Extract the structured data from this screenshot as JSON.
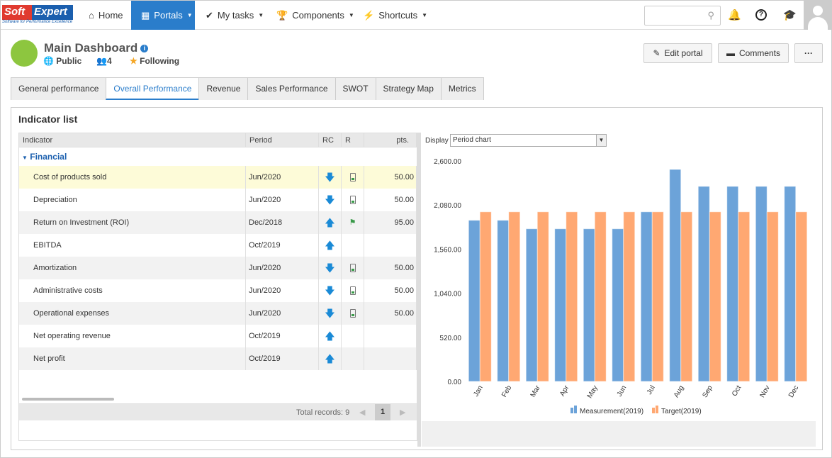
{
  "logo": {
    "text1": "Soft",
    "text2": "Expert",
    "tagline": "Software for Performance Excellence"
  },
  "nav": {
    "home": "Home",
    "portals": "Portals",
    "my_tasks": "My tasks",
    "components": "Components",
    "shortcuts": "Shortcuts"
  },
  "search": {
    "placeholder": ""
  },
  "portal": {
    "title": "Main Dashboard",
    "visibility": "Public",
    "members": "4",
    "following": "Following"
  },
  "actions": {
    "edit": "Edit portal",
    "comments": "Comments",
    "more": "···"
  },
  "tabs": [
    "General performance",
    "Overall Performance",
    "Revenue",
    "Sales Performance",
    "SWOT",
    "Strategy Map",
    "Metrics"
  ],
  "panel": {
    "title": "Indicator list"
  },
  "grid": {
    "headers": [
      "Indicator",
      "Period",
      "RC",
      "R",
      "pts."
    ],
    "group": "Financial",
    "rows": [
      {
        "name": "Cost of products sold",
        "period": "Jun/2020",
        "rc": "down",
        "r": "battery",
        "pts": "50.00"
      },
      {
        "name": "Depreciation",
        "period": "Jun/2020",
        "rc": "down",
        "r": "battery",
        "pts": "50.00"
      },
      {
        "name": "Return on Investment (ROI)",
        "period": "Dec/2018",
        "rc": "up",
        "r": "flag",
        "pts": "95.00"
      },
      {
        "name": "EBITDA",
        "period": "Oct/2019",
        "rc": "up",
        "r": "",
        "pts": ""
      },
      {
        "name": "Amortization",
        "period": "Jun/2020",
        "rc": "down",
        "r": "battery",
        "pts": "50.00"
      },
      {
        "name": "Administrative costs",
        "period": "Jun/2020",
        "rc": "down",
        "r": "battery",
        "pts": "50.00"
      },
      {
        "name": "Operational expenses",
        "period": "Jun/2020",
        "rc": "down",
        "r": "battery",
        "pts": "50.00"
      },
      {
        "name": "Net operating revenue",
        "period": "Oct/2019",
        "rc": "up",
        "r": "",
        "pts": ""
      },
      {
        "name": "Net profit",
        "period": "Oct/2019",
        "rc": "up",
        "r": "",
        "pts": ""
      }
    ],
    "total": "Total records: 9",
    "page": "1"
  },
  "display": {
    "label": "Display",
    "value": "Period chart"
  },
  "chart_data": {
    "type": "bar",
    "categories": [
      "Jan",
      "Feb",
      "Mar",
      "Apr",
      "May",
      "Jun",
      "Jul",
      "Aug",
      "Sep",
      "Oct",
      "Nov",
      "Dec"
    ],
    "series": [
      {
        "name": "Measurement(2019)",
        "color": "#6ca3d9",
        "values": [
          1900,
          1900,
          1800,
          1800,
          1800,
          1800,
          2000,
          2500,
          2300,
          2300,
          2300,
          2300
        ]
      },
      {
        "name": "Target(2019)",
        "color": "#ffa872",
        "values": [
          2000,
          2000,
          2000,
          2000,
          2000,
          2000,
          2000,
          2000,
          2000,
          2000,
          2000,
          2000
        ]
      }
    ],
    "yticks": [
      "0.00",
      "520.00",
      "1,040.00",
      "1,560.00",
      "2,080.00",
      "2,600.00"
    ],
    "ylim": [
      0,
      2600
    ],
    "legend": "bottom",
    "grid": false
  }
}
